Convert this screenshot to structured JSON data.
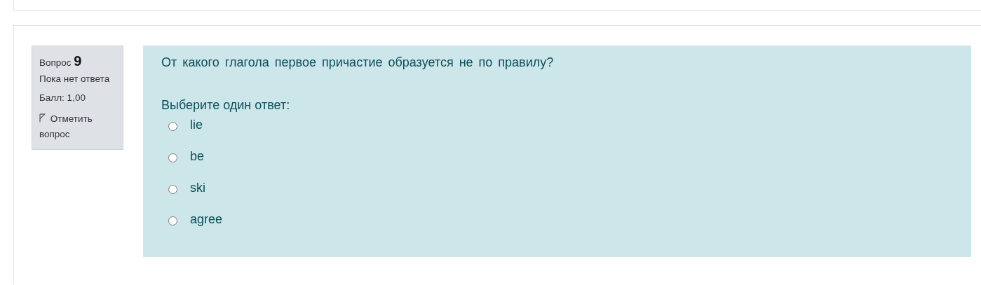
{
  "question_info": {
    "label": "Вопрос",
    "number": "9",
    "status": "Пока нет ответа",
    "score": "Балл: 1,00",
    "flag": {
      "label": "Отметить вопрос",
      "flagged": false
    }
  },
  "question": {
    "text": "От какого глагола первое причастие образуется не по правилу?",
    "prompt": "Выберите один ответ:",
    "options": [
      {
        "label": "lie",
        "selected": false
      },
      {
        "label": "be",
        "selected": false
      },
      {
        "label": "ski",
        "selected": false
      },
      {
        "label": "agree",
        "selected": false
      }
    ]
  }
}
